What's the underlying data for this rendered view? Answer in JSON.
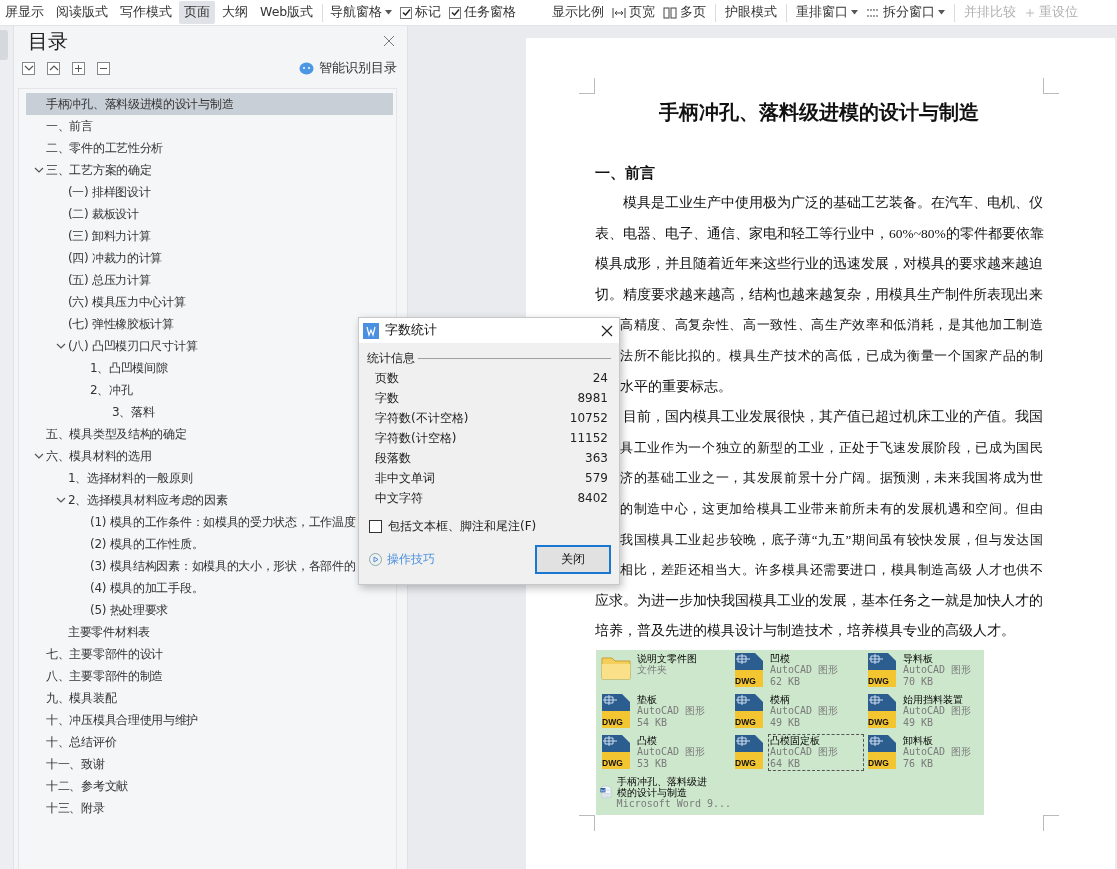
{
  "toolbar": {
    "views": [
      {
        "label": "屏显示",
        "selected": false
      },
      {
        "label": "阅读版式",
        "selected": false
      },
      {
        "label": "写作模式",
        "selected": false
      },
      {
        "label": "页面",
        "selected": true
      },
      {
        "label": "大纲",
        "selected": false
      },
      {
        "label": "Web版式",
        "selected": false
      }
    ],
    "panes": [
      {
        "label": "导航窗格",
        "kind": "dropdown"
      },
      {
        "label": "标记",
        "kind": "checkbox",
        "checked": true
      },
      {
        "label": "任务窗格",
        "kind": "checkbox",
        "checked": true
      }
    ],
    "tools": [
      {
        "label": "显示比例",
        "kind": "button",
        "disabled": false
      },
      {
        "label": "页宽",
        "kind": "page_width",
        "disabled": false
      },
      {
        "label": "多页",
        "kind": "multi_page",
        "disabled": false
      },
      {
        "label": "护眼模式",
        "kind": "button",
        "disabled": false
      },
      {
        "label": "重排窗口",
        "kind": "menu",
        "disabled": false
      },
      {
        "label": "拆分窗口",
        "kind": "split_menu",
        "disabled": false
      },
      {
        "label": "并排比较",
        "kind": "button",
        "disabled": true
      },
      {
        "label": "重设位",
        "kind": "reset",
        "disabled": true
      }
    ]
  },
  "nav": {
    "title": "目录",
    "smart_button": "智能识别目录",
    "tree": [
      {
        "label": "手柄冲孔、落料级进模的设计与制造",
        "selected": true
      },
      {
        "label": "一、前言",
        "selected": false
      },
      {
        "label": "二、零件的工艺性分析",
        "selected": false
      },
      {
        "label": "三、工艺方案的确定",
        "selected": false,
        "expanded": true,
        "children": [
          {
            "label": "(一) 排样图设计",
            "selected": false
          },
          {
            "label": "(二) 裁板设计",
            "selected": false
          },
          {
            "label": "(三) 卸料力计算",
            "selected": false
          },
          {
            "label": "(四) 冲裁力的计算",
            "selected": false
          },
          {
            "label": "(五) 总压力计算",
            "selected": false
          },
          {
            "label": "(六) 模具压力中心计算",
            "selected": false
          },
          {
            "label": "(七) 弹性橡胶板计算",
            "selected": false
          },
          {
            "label": "(八) 凸凹模刃口尺寸计算",
            "selected": false,
            "expanded": true,
            "children": [
              {
                "label": "1、凸凹模间隙",
                "selected": false
              },
              {
                "label": "2、冲孔",
                "selected": false,
                "children": [
                  {
                    "label": "3、落料",
                    "selected": false
                  }
                ]
              }
            ]
          }
        ]
      },
      {
        "label": "五、模具类型及结构的确定",
        "selected": false
      },
      {
        "label": "六、模具材料的选用",
        "selected": false,
        "expanded": true,
        "children": [
          {
            "label": "1、选择材料的一般原则",
            "selected": false
          },
          {
            "label": "2、选择模具材料应考虑的因素",
            "selected": false,
            "expanded": true,
            "children": [
              {
                "label": "(1) 模具的工作条件：如模具的受力状态，工作温度",
                "selected": false
              },
              {
                "label": "(2) 模具的工作性质。",
                "selected": false
              },
              {
                "label": "(3) 模具结构因素：如模具的大小，形状，各部件的",
                "selected": false
              },
              {
                "label": "(4) 模具的加工手段。",
                "selected": false
              },
              {
                "label": "(5) 热处理要求",
                "selected": false
              }
            ]
          },
          {
            "label": "主要零件材料表",
            "selected": false
          }
        ]
      },
      {
        "label": "七、主要零部件的设计",
        "selected": false
      },
      {
        "label": "八、主要零部件的制造",
        "selected": false
      },
      {
        "label": "九、模具装配",
        "selected": false
      },
      {
        "label": "十、冲压模具合理使用与维护",
        "selected": false
      },
      {
        "label": "十、总结评价",
        "selected": false
      },
      {
        "label": "十一、致谢",
        "selected": false
      },
      {
        "label": "十二、参考文献",
        "selected": false
      },
      {
        "label": "十三、附录",
        "selected": false
      }
    ]
  },
  "document": {
    "title": "手柄冲孔、落料级进模的设计与制造",
    "heading": "一、前言",
    "lines": [
      {
        "text": "模具是工业生产中使用极为广泛的基础工艺装备。在汽车、电机、仪",
        "kind": "first"
      },
      {
        "text": "表、电器、电子、通信、家电和轻工等行业中，60%~80%的零件都要依靠",
        "kind": "full"
      },
      {
        "text": "模具成形，并且随着近年来这些行业的迅速发展，对模具的要求越来越迫",
        "kind": "full"
      },
      {
        "text": "切。精度要求越来越高，结构也越来越复杂，用模具生产制件所表现出来",
        "kind": "full"
      },
      {
        "text": "高精度、高复杂性、高一致性、高生产效率和低消耗，是其他加工制造",
        "kind": "covered"
      },
      {
        "text": "法所不能比拟的。模具生产技术的高低，已成为衡量一个国家产品的制",
        "kind": "covered"
      },
      {
        "text": "水平的重要标志。",
        "kind": "covered_last"
      },
      {
        "text": "目前，国内模具工业发展很快，其产值已超过机床工业的产值。我国",
        "kind": "first"
      },
      {
        "text": "具工业作为一个独立的新型的工业，正处于飞速发展阶段，已成为国民",
        "kind": "covered"
      },
      {
        "text": "济的基础工业之一，其发展前景十分广阔。据预测，未来我国将成为世",
        "kind": "covered"
      },
      {
        "text": "的制造中心，这更加给模具工业带来前所未有的发展机遇和空间。但由",
        "kind": "covered"
      },
      {
        "text": "我国模具工业起步较晚，底子薄“九五”期间虽有较快发展，但与发达国",
        "kind": "covered"
      },
      {
        "text": "相比，差距还相当大。许多模具还需要进口，模具制造高级  人才也供不",
        "kind": "covered"
      },
      {
        "text": "应求。为进一步加快我国模具工业的发展，基本任务之一就是加快人才的",
        "kind": "full"
      },
      {
        "text": "培养，普及先进的模具设计与制造技术，培养模具专业的高级人才。",
        "kind": "last"
      }
    ],
    "files": [
      {
        "name": "说明文零件图",
        "type": "文件夹",
        "kind": "folder",
        "selected": false
      },
      {
        "name": "凹模",
        "type": "AutoCAD 图形",
        "size": "62 KB",
        "badge": "DWG",
        "kind": "dwg",
        "selected": false
      },
      {
        "name": "导料板",
        "type": "AutoCAD 图形",
        "size": "70 KB",
        "badge": "DWG",
        "kind": "dwg",
        "selected": false
      },
      {
        "name": "垫板",
        "type": "AutoCAD 图形",
        "size": "54 KB",
        "badge": "DWG",
        "kind": "dwg",
        "selected": false
      },
      {
        "name": "模柄",
        "type": "AutoCAD 图形",
        "size": "49 KB",
        "badge": "DWG",
        "kind": "dwg",
        "selected": false
      },
      {
        "name": "始用挡料装置",
        "type": "AutoCAD 图形",
        "size": "49 KB",
        "badge": "DWG",
        "kind": "dwg",
        "selected": false
      },
      {
        "name": "凸模",
        "type": "AutoCAD 图形",
        "size": "53 KB",
        "badge": "DWG",
        "kind": "dwg",
        "selected": false
      },
      {
        "name": "凸模固定板",
        "type": "AutoCAD 图形",
        "size": "64 KB",
        "badge": "DWG",
        "kind": "dwg",
        "selected": true
      },
      {
        "name": "卸料板",
        "type": "AutoCAD 图形",
        "size": "76 KB",
        "badge": "DWG",
        "kind": "dwg",
        "selected": false
      },
      {
        "name": "手柄冲孔、落料级进模的设计与制造",
        "type": "Microsoft Word 9...",
        "kind": "word",
        "selected": false
      }
    ]
  },
  "dialog": {
    "title": "字数统计",
    "section": "统计信息",
    "stats": [
      {
        "label": "页数",
        "value": "24"
      },
      {
        "label": "字数",
        "value": "8981"
      },
      {
        "label": "字符数(不计空格)",
        "value": "10752"
      },
      {
        "label": "字符数(计空格)",
        "value": "11152"
      },
      {
        "label": "段落数",
        "value": "363"
      },
      {
        "label": "非中文单词",
        "value": "579"
      },
      {
        "label": "中文字符",
        "value": "8402"
      }
    ],
    "option": {
      "label": "包括文本框、脚注和尾注(F)",
      "checked": false
    },
    "tips_link": "操作技巧",
    "close_button": "关闭"
  }
}
